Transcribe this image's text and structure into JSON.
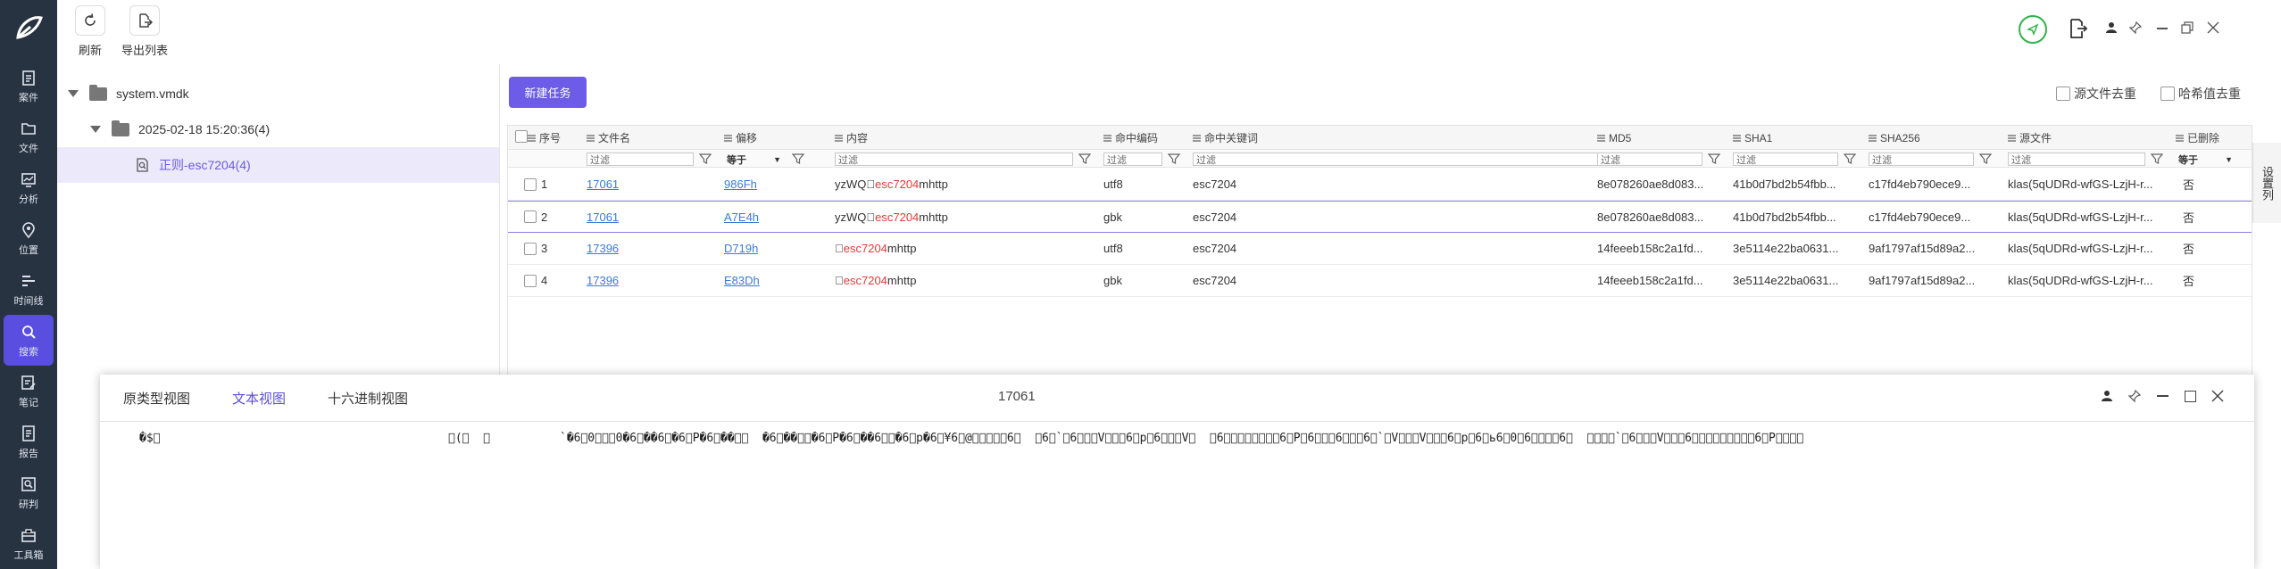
{
  "sidebar": {
    "items": [
      {
        "label": "案件",
        "icon": "case-icon"
      },
      {
        "label": "文件",
        "icon": "file-icon"
      },
      {
        "label": "分析",
        "icon": "analysis-icon"
      },
      {
        "label": "位置",
        "icon": "location-icon"
      },
      {
        "label": "时间线",
        "icon": "timeline-icon"
      },
      {
        "label": "搜索",
        "icon": "search-icon",
        "active": true
      },
      {
        "label": "笔记",
        "icon": "note-icon"
      },
      {
        "label": "报告",
        "icon": "report-icon"
      },
      {
        "label": "研判",
        "icon": "judge-icon"
      },
      {
        "label": "工具箱",
        "icon": "toolbox-icon"
      }
    ],
    "accent": "#5a4ee0"
  },
  "toolbar": {
    "refresh_label": "刷新",
    "export_label": "导出列表"
  },
  "tree": {
    "root": "system.vmdk",
    "child": "2025-02-18 15:20:36(4)",
    "leaf": "正则-esc7204(4)"
  },
  "actions": {
    "new_task": "新建任务",
    "dedupe_source": "源文件去重",
    "dedupe_hash": "哈希值去重"
  },
  "grid": {
    "headers": {
      "seq": "序号",
      "name": "文件名",
      "offset": "偏移",
      "content": "内容",
      "encoding": "命中编码",
      "keyword": "命中关键词",
      "md5": "MD5",
      "sha1": "SHA1",
      "sha256": "SHA256",
      "source": "源文件",
      "deleted": "已删除"
    },
    "filter_placeholder": "过滤",
    "offset_filter": "等于",
    "deleted_filter": "等于",
    "rows": [
      {
        "seq": "1",
        "name": "17061",
        "offset": "986Fh",
        "pre": "yzWQ\u0000",
        "hit": "esc7204",
        "post": "mhttp",
        "encoding": "utf8",
        "keyword": "esc7204",
        "md5": "8e078260ae8d083...",
        "sha1": "41b0d7bd2b54fbb...",
        "sha256": "c17fd4eb790ece9...",
        "source": "klas(5qUDRd-wfGS-LzjH-r...",
        "deleted": "否"
      },
      {
        "seq": "2",
        "name": "17061",
        "offset": "A7E4h",
        "pre": "yzWQ\u0000",
        "hit": "esc7204",
        "post": "mhttp",
        "encoding": "gbk",
        "keyword": "esc7204",
        "md5": "8e078260ae8d083...",
        "sha1": "41b0d7bd2b54fbb...",
        "sha256": "c17fd4eb790ece9...",
        "source": "klas(5qUDRd-wfGS-LzjH-r...",
        "deleted": "否"
      },
      {
        "seq": "3",
        "name": "17396",
        "offset": "D719h",
        "pre": "\u0000",
        "hit": "esc7204",
        "post": "mhttp",
        "encoding": "utf8",
        "keyword": "esc7204",
        "md5": "14feeeb158c2a1fd...",
        "sha1": "3e5114e22ba0631...",
        "sha256": "9af1797af15d89a2...",
        "source": "klas(5qUDRd-wfGS-LzjH-r...",
        "deleted": "否"
      },
      {
        "seq": "4",
        "name": "17396",
        "offset": "E83Dh",
        "pre": "\u0000",
        "hit": "esc7204",
        "post": "mhttp",
        "encoding": "gbk",
        "keyword": "esc7204",
        "md5": "14feeeb158c2a1fd...",
        "sha1": "3e5114e22ba0631...",
        "sha256": "9af1797af15d89a2...",
        "source": "klas(5qUDRd-wfGS-LzjH-r...",
        "deleted": "否"
      }
    ]
  },
  "side_tab": "设置列",
  "dialog": {
    "tabs": [
      "原类型视图",
      "文本视图",
      "十六进制视图"
    ],
    "active_tab": "文本视图",
    "title": "17061",
    "text_a": "�$\u0000",
    "text_b": "\u0000(\u0000  \u0000",
    "text_c": "`�6\u00000\u0000\u0000\u00000�6\u0000��6\u0000�6\u0000P�6\u0000��\u0000\u0000  �6\u0000��\u0000\u0000�6\u0000P�6\u0000��6\u0000\u0000�6\u0000p�6\u0000¥6\u0000@\u0000\u0000\u0000\u0000\u00006\u0000  \u00006\u0000`\u00006\u0000\u0000\u0000V\u0000\u0000\u00006\u0000p\u00006\u0000\u0000\u0000V\u0000  \u00006\u0000\u0000\u0000\u0000\u0000\u0000\u0000\u00006\u0000P\u00006\u0000\u0000\u00006\u0000\u0000\u00006\u0000`\u0000V\u0000\u0000\u0000V\u0000\u0000\u00006\u0000p\u00006\u0000ь6\u00000\u00006\u0000\u0000\u0000\u00006\u0000  \u0000\u0000\u0000\u0000`\u00006\u0000\u0000\u0000V\u0000\u0000\u00006\u0000\u0000\u0000\u0000\u0000\u0000\u0000\u0000\u00006\u0000P\u0000\u0000\u0000\u0000"
  },
  "colors": {
    "link": "#3b7ad9",
    "hit": "#e53935",
    "sidebar_bg": "#283342"
  }
}
